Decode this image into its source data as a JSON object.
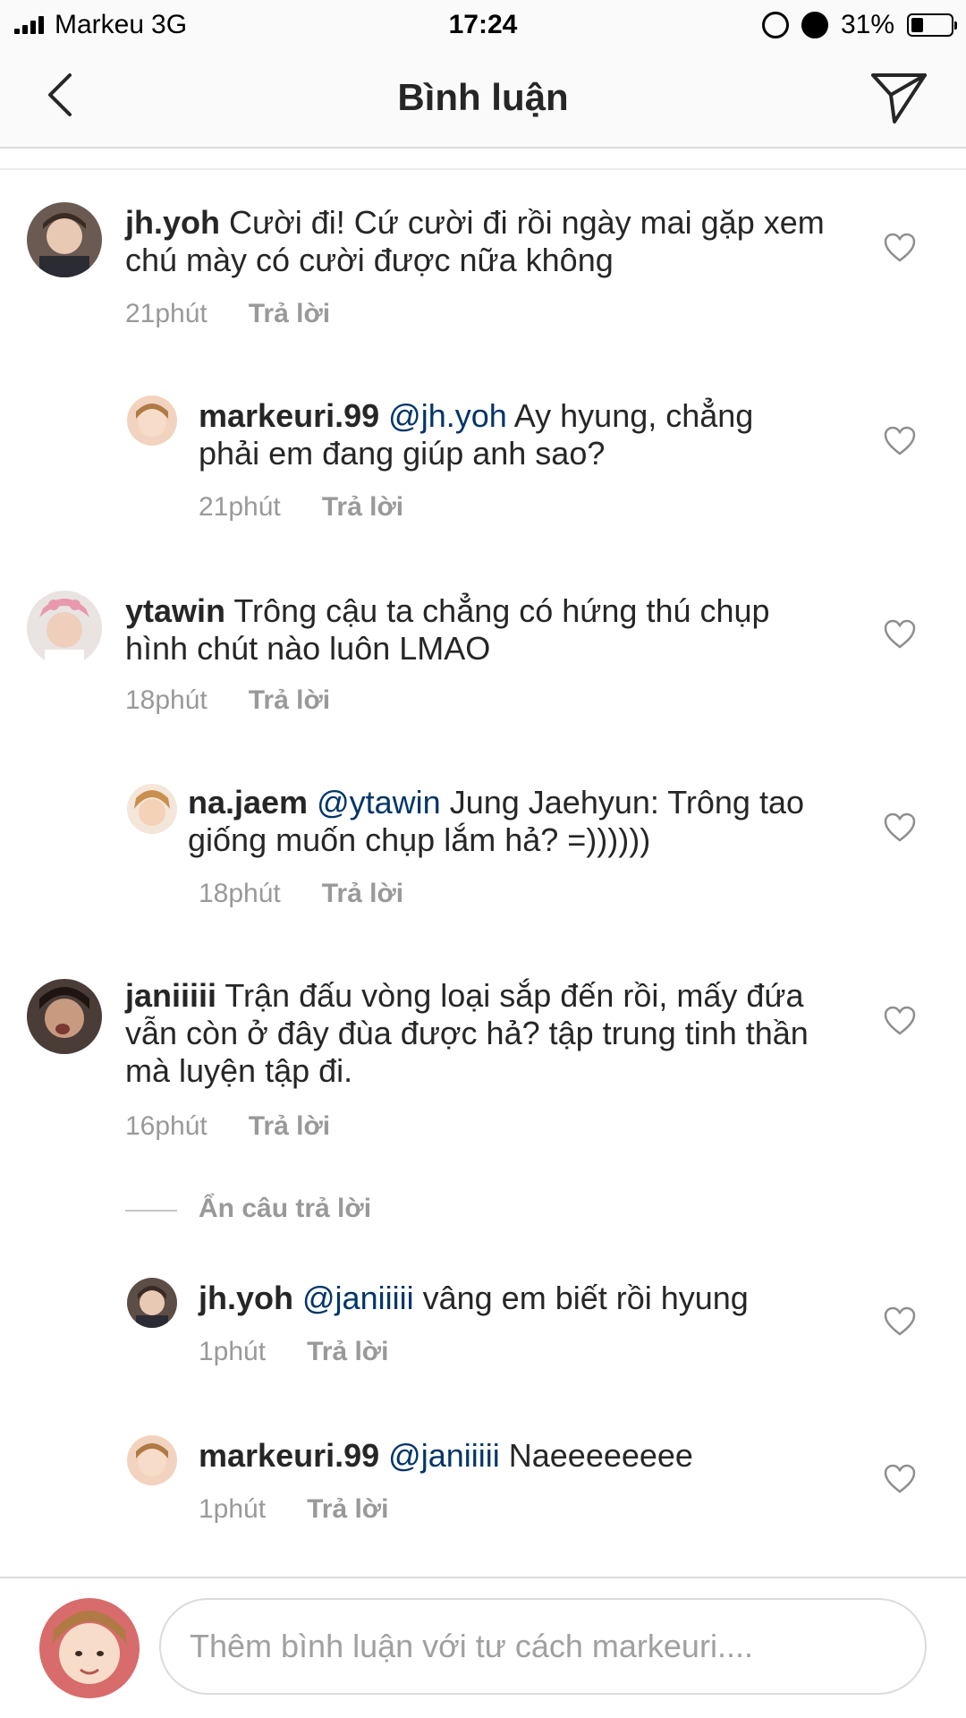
{
  "status_bar": {
    "carrier": "Markeu",
    "network": "3G",
    "time": "17:24",
    "battery": "31%",
    "battery_level": 0.31
  },
  "header": {
    "title": "Bình luận",
    "back_icon": "chevron-left-icon",
    "send_icon": "paper-plane-icon"
  },
  "comments": [
    {
      "username": "jh.yoh",
      "mention": "",
      "text": "Cười đi! Cứ cười đi rồi ngày mai gặp xem chú mày có cười được nữa không",
      "time": "21phút",
      "reply": "Trả lời"
    },
    {
      "username": "markeuri.99",
      "mention": "@jh.yoh",
      "text": "Ay hyung, chẳng phải em đang giúp anh sao?",
      "time": "21phút",
      "reply": "Trả lời"
    },
    {
      "username": "ytawin",
      "mention": "",
      "text": "Trông cậu ta chẳng có hứng thú chụp hình chút nào luôn LMAO",
      "time": "18phút",
      "reply": "Trả lời"
    },
    {
      "username": "na.jaem",
      "mention": "@ytawin",
      "text": "Jung Jaehyun: Trông tao giống muốn chụp lắm hả? =))))))",
      "time": "18phút",
      "reply": "Trả lời"
    },
    {
      "username": "janiiiii",
      "mention": "",
      "text": "Trận đấu vòng loại sắp đến rồi, mấy đứa vẫn còn ở đây đùa được hả? tập trung tinh thần mà luyện tập đi.",
      "time": "16phút",
      "reply": "Trả lời"
    },
    {
      "username": "jh.yoh",
      "mention": "@janiiiii",
      "text": "vâng em biết rồi hyung",
      "time": "1phút",
      "reply": "Trả lời"
    },
    {
      "username": "markeuri.99",
      "mention": "@janiiiii",
      "text": "Naeeeeeeee",
      "time": "1phút",
      "reply": "Trả lời"
    }
  ],
  "hide_replies": "Ẩn câu trả lời",
  "composer": {
    "placeholder": "Thêm bình luận với tư cách markeuri...."
  },
  "colors": {
    "mention": "#003569",
    "meta": "#999999",
    "text": "#262626",
    "border": "#dbdbdb"
  }
}
